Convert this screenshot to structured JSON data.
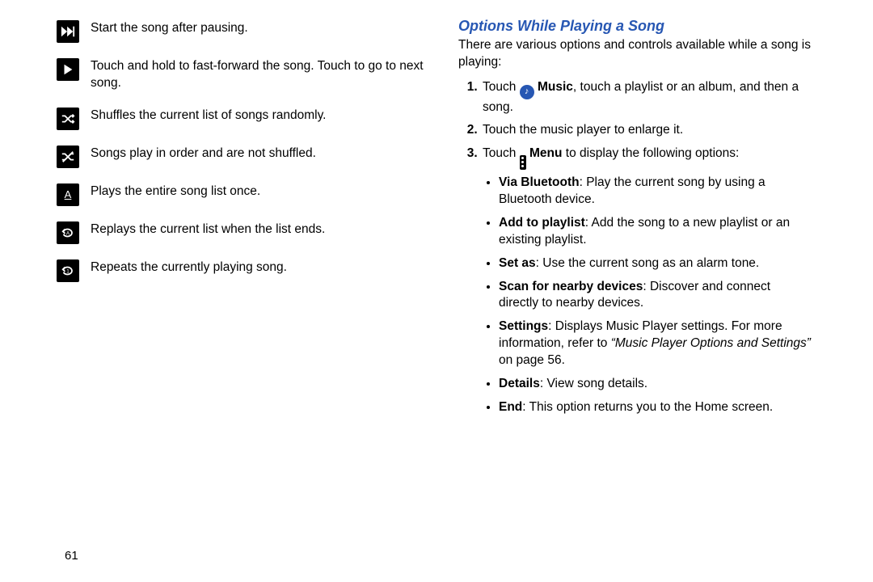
{
  "page_number": "61",
  "left": {
    "rows": [
      {
        "icon": "fast-forward-icon",
        "text": "Start the song after pausing."
      },
      {
        "icon": "play-icon",
        "text": "Touch and hold to fast-forward the song. Touch to go to next song."
      },
      {
        "icon": "shuffle-on-icon",
        "text": "Shuffles the current list of songs randomly."
      },
      {
        "icon": "shuffle-off-icon",
        "text": "Songs play in order and are not shuffled."
      },
      {
        "icon": "play-once-icon",
        "text": "Plays the entire song list once."
      },
      {
        "icon": "repeat-all-icon",
        "text": "Replays the current list when the list ends."
      },
      {
        "icon": "repeat-one-icon",
        "text": "Repeats the currently playing song."
      }
    ]
  },
  "right": {
    "heading": "Options While Playing a Song",
    "intro": "There are various options and controls available while a song is playing:",
    "step1_pre": "Touch ",
    "step1_bold": "Music",
    "step1_post": ", touch a playlist or an album, and then a song.",
    "step2": "Touch the music player to enlarge it.",
    "step3_pre": "Touch ",
    "step3_bold": "Menu",
    "step3_post": " to display the following options:",
    "bullets": [
      {
        "b": "Via Bluetooth",
        "rest": ": Play the current song by using a Bluetooth device."
      },
      {
        "b": "Add to playlist",
        "rest": ": Add the song to a new playlist or an existing playlist."
      },
      {
        "b": "Set as",
        "rest": ": Use the current song as an alarm tone."
      },
      {
        "b": "Scan for nearby devices",
        "rest": ": Discover and connect directly to nearby devices."
      },
      {
        "b": "Settings",
        "rest": ": Displays Music Player settings. For more information, refer to ",
        "ital": "“Music Player Options and Settings”",
        "tail": " on page 56."
      },
      {
        "b": "Details",
        "rest": ": View song details."
      },
      {
        "b": "End",
        "rest": ": This option returns you to the Home screen."
      }
    ]
  }
}
